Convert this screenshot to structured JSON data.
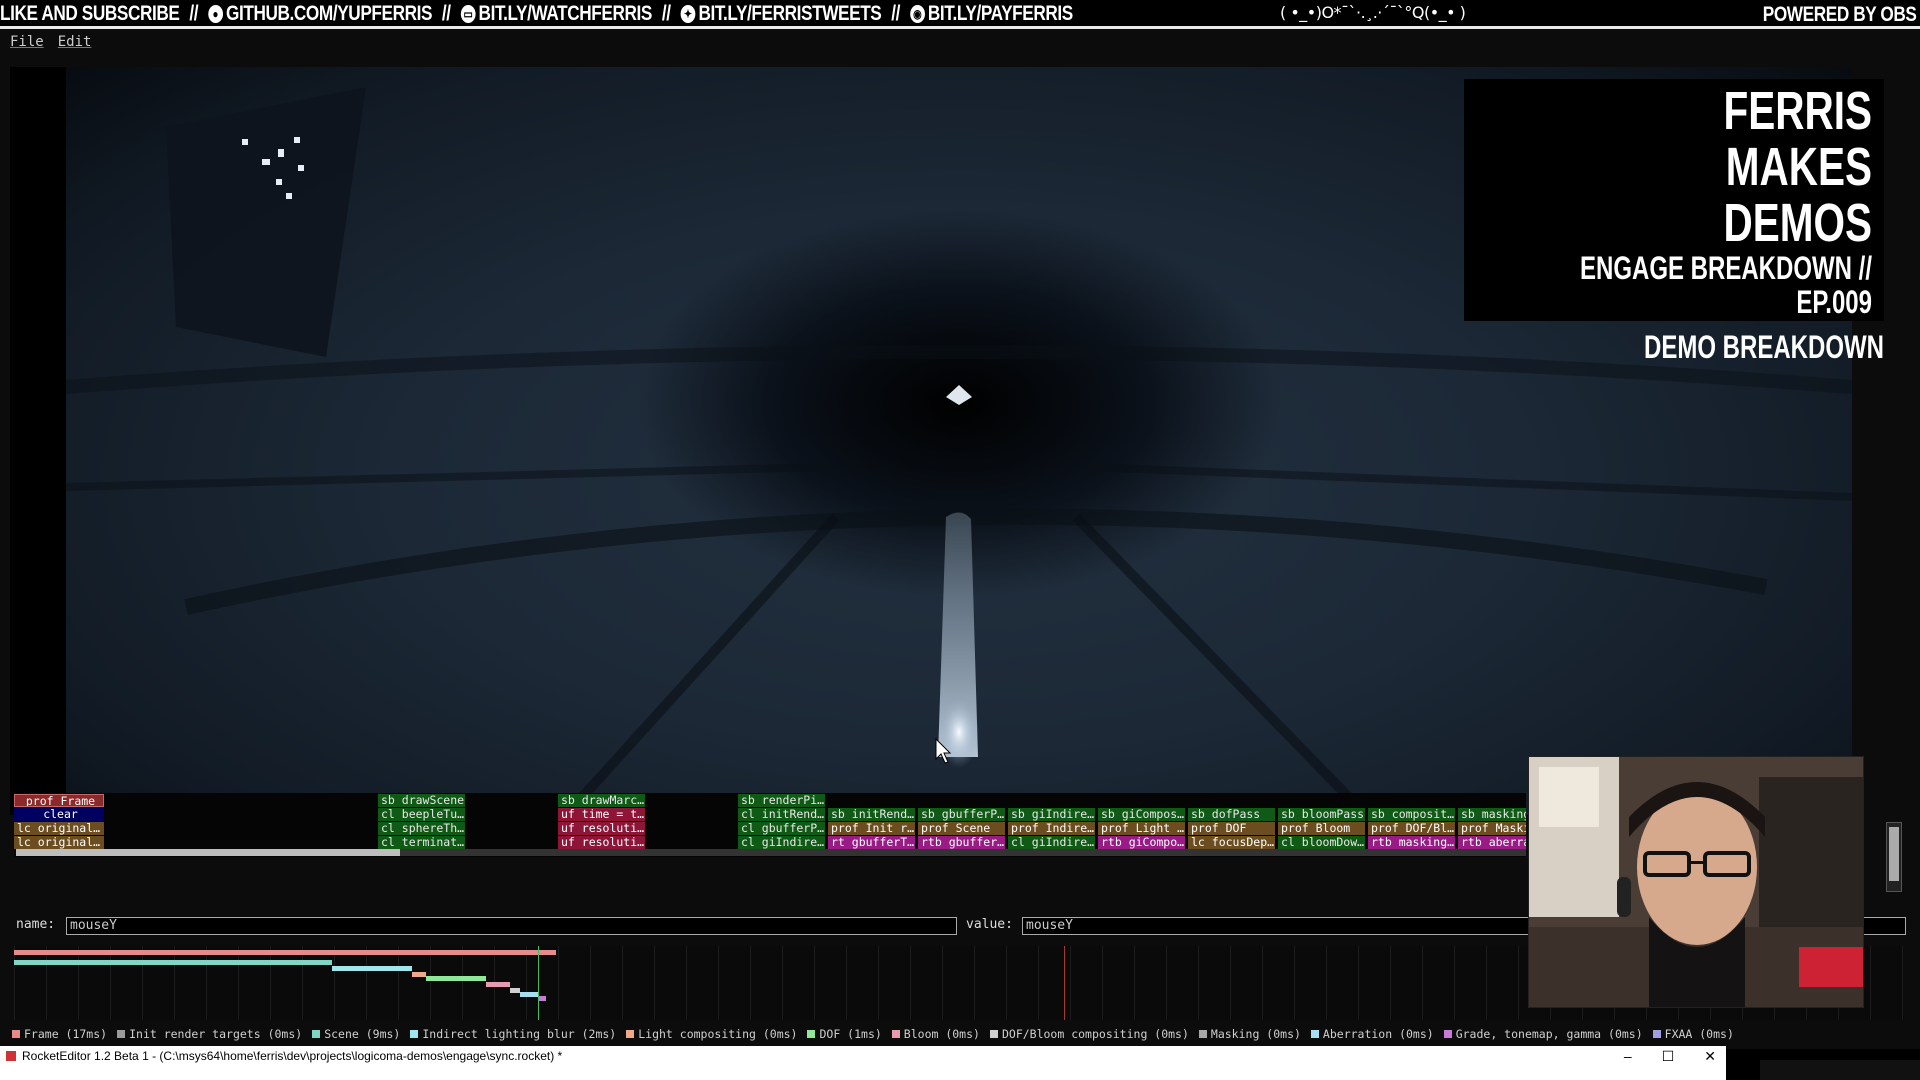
{
  "banner": {
    "items": [
      {
        "icon": "",
        "text": "LIKE AND SUBSCRIBE"
      },
      {
        "icon": "github-icon",
        "text": "GITHUB.COM/YUPFERRIS"
      },
      {
        "icon": "twitch-icon",
        "text": "BIT.LY/WATCHFERRIS"
      },
      {
        "icon": "twitter-icon",
        "text": "BIT.LY/FERRISTWEETS"
      },
      {
        "icon": "patreon-icon",
        "text": "BIT.LY/PAYFERRIS"
      }
    ],
    "separator": "//",
    "ascii_art": "( •_•)O*¯`·.¸.·´¯`°Q(•_• )",
    "powered_by": "POWERED BY OBS"
  },
  "menu": {
    "file": "File",
    "edit": "Edit"
  },
  "overlay": {
    "title": "FERRIS MAKES DEMOS",
    "subtitle": "ENGAGE BREAKDOWN // EP.009",
    "tag": "DEMO BREAKDOWN"
  },
  "tracks": {
    "rows": [
      [
        {
          "label": "prof Frame",
          "style": "prof-hl"
        },
        {
          "label": "sb drawScene",
          "style": "green"
        },
        {
          "label": "sb drawMarc…",
          "style": "green"
        },
        {
          "label": "sb renderPi…",
          "style": "green"
        }
      ],
      [
        {
          "label": "clear",
          "style": "clear"
        },
        {
          "label": "cl beepleTu…",
          "style": "green"
        },
        {
          "label": "uf time = t…",
          "style": "red"
        },
        {
          "label": "cl initRend…",
          "style": "green"
        },
        {
          "label": "sb initRend…",
          "style": "green"
        },
        {
          "label": "sb gbufferP…",
          "style": "green"
        },
        {
          "label": "sb giIndire…",
          "style": "green"
        },
        {
          "label": "sb giCompos…",
          "style": "green"
        },
        {
          "label": "sb dofPass",
          "style": "green"
        },
        {
          "label": "sb bloomPass",
          "style": "green"
        },
        {
          "label": "sb composit…",
          "style": "green"
        },
        {
          "label": "sb masking",
          "style": "green"
        }
      ],
      [
        {
          "label": "lc original…",
          "style": "lc"
        },
        {
          "label": "cl sphereTh…",
          "style": "green"
        },
        {
          "label": "uf resoluti…",
          "style": "red"
        },
        {
          "label": "cl gbufferP…",
          "style": "green"
        },
        {
          "label": "prof Init r…",
          "style": "olive"
        },
        {
          "label": "prof Scene",
          "style": "olive"
        },
        {
          "label": "prof Indire…",
          "style": "olive"
        },
        {
          "label": "prof Light …",
          "style": "olive"
        },
        {
          "label": "prof DOF",
          "style": "olive"
        },
        {
          "label": "prof Bloom",
          "style": "olive"
        },
        {
          "label": "prof DOF/Bl…",
          "style": "olive"
        },
        {
          "label": "prof Maski",
          "style": "olive"
        }
      ],
      [
        {
          "label": "lc original…",
          "style": "lc"
        },
        {
          "label": "cl terminat…",
          "style": "green"
        },
        {
          "label": "uf resoluti…",
          "style": "red"
        },
        {
          "label": "cl giIndire…",
          "style": "green"
        },
        {
          "label": "rt gbufferT…",
          "style": "magenta"
        },
        {
          "label": "rtb gbuffer…",
          "style": "magenta"
        },
        {
          "label": "cl giIndire…",
          "style": "green"
        },
        {
          "label": "rtb giCompo…",
          "style": "magenta"
        },
        {
          "label": "lc focusDep…",
          "style": "olive"
        },
        {
          "label": "cl bloomDow…",
          "style": "green"
        },
        {
          "label": "rtb masking…",
          "style": "magenta"
        },
        {
          "label": "rtb aberra",
          "style": "magenta"
        }
      ]
    ]
  },
  "fields": {
    "name_label": "name:",
    "name_value": "mouseY",
    "value_label": "value:",
    "value_value": "mouseY"
  },
  "legend": [
    {
      "label": "Frame (17ms)",
      "color": "#e88a8a"
    },
    {
      "label": "Init render targets (0ms)",
      "color": "#9a9a9a"
    },
    {
      "label": "Scene (9ms)",
      "color": "#7fd6c4"
    },
    {
      "label": "Indirect lighting blur (2ms)",
      "color": "#9fe6ef"
    },
    {
      "label": "Light compositing (0ms)",
      "color": "#f0a88a"
    },
    {
      "label": "DOF (1ms)",
      "color": "#8fe89a"
    },
    {
      "label": "Bloom (0ms)",
      "color": "#e89ab0"
    },
    {
      "label": "DOF/Bloom compositing (0ms)",
      "color": "#d0d0d0"
    },
    {
      "label": "Masking (0ms)",
      "color": "#a8a8a8"
    },
    {
      "label": "Aberration (0ms)",
      "color": "#a8dff0"
    },
    {
      "label": "Grade, tonemap, gamma (0ms)",
      "color": "#c97ad8"
    },
    {
      "label": "FXAA (0ms)",
      "color": "#a0a0e0"
    }
  ],
  "window": {
    "title": "RocketEditor 1.2 Beta 1 - (C:\\msys64\\home\\ferris\\dev\\projects\\logicoma-demos\\engage\\sync.rocket) *",
    "minimize": "–",
    "maximize": "☐",
    "close": "✕"
  }
}
